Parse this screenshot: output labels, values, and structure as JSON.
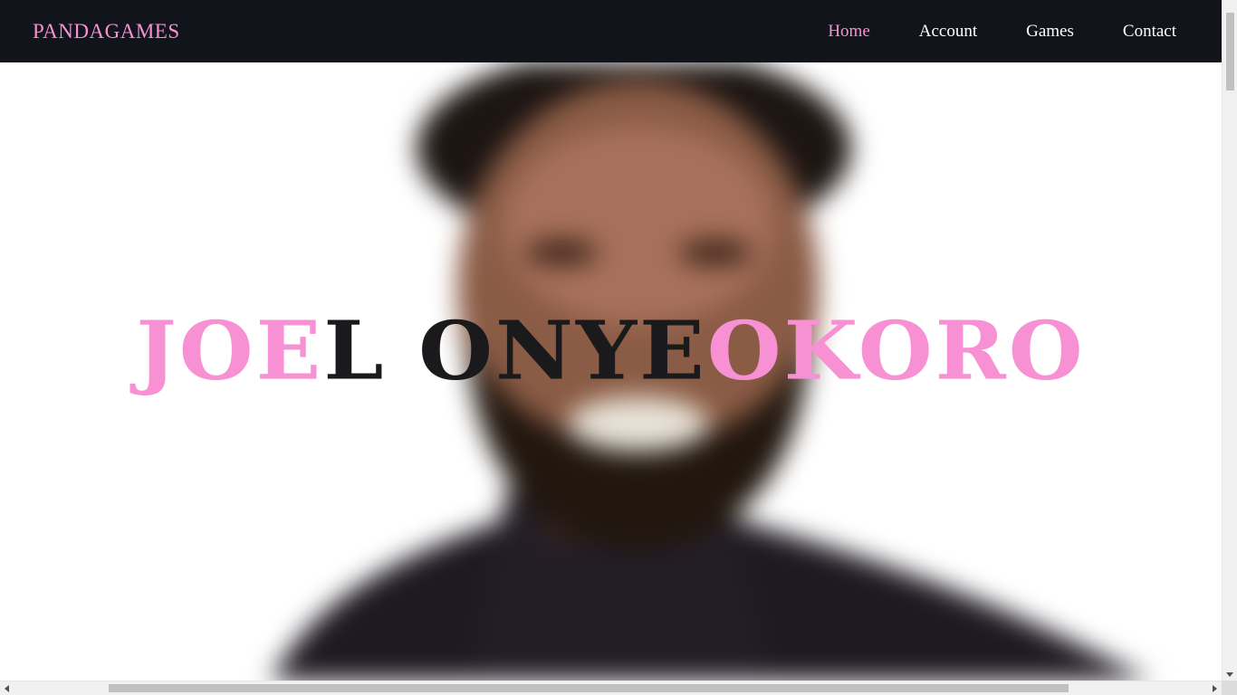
{
  "navbar": {
    "brand": "PANDAGAMES",
    "links": [
      {
        "label": "Home",
        "active": true
      },
      {
        "label": "Account",
        "active": false
      },
      {
        "label": "Games",
        "active": false
      },
      {
        "label": "Contact",
        "active": false
      }
    ]
  },
  "hero": {
    "title_segments": [
      {
        "text": "JOE",
        "color": "pink"
      },
      {
        "text": "L ONYE",
        "color": "dark"
      },
      {
        "text": "OKORO",
        "color": "pink"
      }
    ],
    "background_image": "blurred-portrait-smiling-man"
  },
  "colors": {
    "accent_pink": "#f791d3",
    "navbar_bg": "#12141c",
    "dark_text": "#1a1a1c"
  },
  "icons": {
    "scroll_up": "chevron-up-icon",
    "scroll_down": "chevron-down-icon",
    "scroll_left": "chevron-left-icon",
    "scroll_right": "chevron-right-icon"
  }
}
